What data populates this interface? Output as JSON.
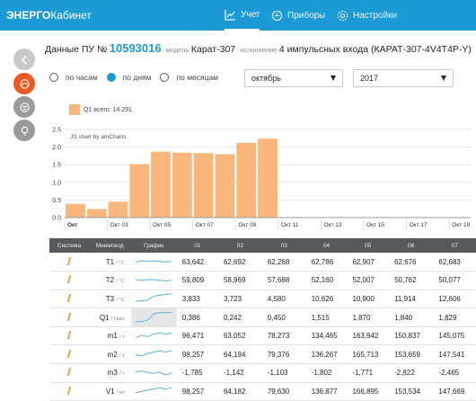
{
  "app": {
    "logo_bold": "ЭНЕРГО",
    "logo_rest": "Кабинет"
  },
  "nav": {
    "items": [
      {
        "label": "Учет",
        "icon": "line-chart-icon",
        "active": true
      },
      {
        "label": "Приборы",
        "icon": "device-icon",
        "active": false
      },
      {
        "label": "Настройки",
        "icon": "gear-icon",
        "active": false
      }
    ]
  },
  "header": {
    "prefix": "Данные ПУ №",
    "device_number": "10593016",
    "model_label": "модель",
    "model": "Карат-307",
    "exec_label": "исполнение",
    "exec": "4 импульсных входа (КАРАТ-307-4V4T4P-Y)"
  },
  "period": {
    "options": [
      "по часам",
      "по дням",
      "по месяцам"
    ],
    "selected": "по дням"
  },
  "selects": {
    "month": "октябрь",
    "year": "2017"
  },
  "legend": {
    "label": "Q1 всего: 14.291",
    "color": "#f8b67a"
  },
  "chart_credit": "JS chart by amCharts",
  "chart_data": {
    "type": "bar",
    "series": [
      {
        "name": "Q1",
        "values": [
          0.386,
          0.242,
          0.45,
          1.515,
          1.87,
          1.84,
          1.829,
          1.8,
          2.12,
          2.24
        ]
      }
    ],
    "x": [
      1,
      2,
      3,
      4,
      5,
      6,
      7,
      8,
      9,
      10
    ],
    "ylim": [
      0,
      2.5
    ],
    "yticks": [
      "0.0",
      "0.5",
      "1.0",
      "1.5",
      "2.0",
      "2.5"
    ],
    "xticks": [
      {
        "day": 1,
        "label": "Окт"
      },
      {
        "day": 3,
        "label": "Окт 03"
      },
      {
        "day": 5,
        "label": "Окт 05"
      },
      {
        "day": 7,
        "label": "Окт 07"
      },
      {
        "day": 9,
        "label": "Окт 09"
      },
      {
        "day": 11,
        "label": "Окт 11"
      },
      {
        "day": 13,
        "label": "Окт 13"
      },
      {
        "day": 15,
        "label": "Окт 15"
      },
      {
        "day": 17,
        "label": "Окт 17"
      },
      {
        "day": 19,
        "label": "Окт 19"
      }
    ],
    "xlim": [
      1,
      20
    ],
    "color": "#f8b67a",
    "grid": true
  },
  "table": {
    "headers": [
      "Система",
      "Мнемокод",
      "График",
      "01",
      "02",
      "03",
      "04",
      "05",
      "06",
      "07"
    ],
    "rows": [
      {
        "code": "T1",
        "unit": "/ °C",
        "spark": [
          0.4,
          0.5,
          0.45,
          0.5,
          0.45,
          0.4,
          0.45
        ],
        "vals": [
          "63,642",
          "62,692",
          "62,268",
          "62,786",
          "62,907",
          "62,676",
          "62,683"
        ]
      },
      {
        "code": "T2",
        "unit": "/ °C",
        "spark": [
          0.5,
          0.45,
          0.5,
          0.5,
          0.45,
          0.4,
          0.45
        ],
        "vals": [
          "59,809",
          "58,969",
          "57,688",
          "52,160",
          "52,007",
          "50,762",
          "50,077"
        ]
      },
      {
        "code": "T3",
        "unit": "/ °C",
        "spark": [
          0.2,
          0.25,
          0.3,
          0.6,
          0.7,
          0.75,
          0.8
        ],
        "vals": [
          "3,833",
          "3,723",
          "4,580",
          "10,626",
          "10,900",
          "11,914",
          "12,606"
        ]
      },
      {
        "code": "Q1",
        "unit": "/ Гкал",
        "spark": [
          0.1,
          0.1,
          0.2,
          0.7,
          0.8,
          0.8,
          0.8
        ],
        "vals": [
          "0,386",
          "0,242",
          "0,450",
          "1,515",
          "1,870",
          "1,840",
          "1,829"
        ],
        "hl": true
      },
      {
        "code": "m1",
        "unit": "/ т",
        "spark": [
          0.3,
          0.5,
          0.4,
          0.6,
          0.7,
          0.6,
          0.7
        ],
        "vals": [
          "96,471",
          "63,052",
          "78,273",
          "134,465",
          "163,942",
          "150,837",
          "145,075"
        ]
      },
      {
        "code": "m2",
        "unit": "/ т",
        "spark": [
          0.4,
          0.3,
          0.5,
          0.6,
          0.7,
          0.6,
          0.7
        ],
        "vals": [
          "98,257",
          "64,194",
          "79,376",
          "136,267",
          "165,713",
          "153,659",
          "147,541"
        ]
      },
      {
        "code": "m3",
        "unit": "/ т",
        "spark": [
          0.5,
          0.6,
          0.5,
          0.4,
          0.5,
          0.3,
          0.4
        ],
        "vals": [
          "-1,785",
          "-1,142",
          "-1,103",
          "-1,802",
          "-1,771",
          "-2,822",
          "-2,465"
        ]
      },
      {
        "code": "V1",
        "unit": "/ м³",
        "spark": [
          0.3,
          0.4,
          0.5,
          0.6,
          0.7,
          0.6,
          0.7
        ],
        "vals": [
          "98,257",
          "64,182",
          "79,630",
          "136,877",
          "166,895",
          "153,534",
          "147,669"
        ]
      }
    ]
  }
}
